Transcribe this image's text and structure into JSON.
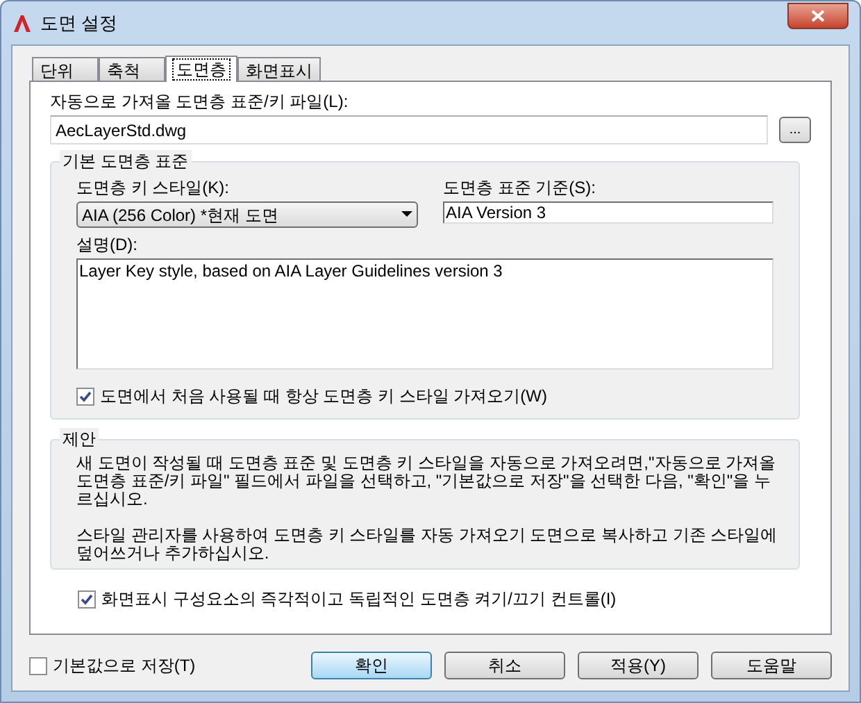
{
  "window": {
    "title": "도면 설정"
  },
  "tabs": [
    {
      "label": "단위",
      "selected": false
    },
    {
      "label": "축척",
      "selected": false
    },
    {
      "label": "도면층",
      "selected": true
    },
    {
      "label": "화면표시",
      "selected": false
    }
  ],
  "file": {
    "label": "자동으로 가져올 도면층 표준/키 파일(L):",
    "value": "AecLayerStd.dwg",
    "browse": "..."
  },
  "default_standard": {
    "title": "기본 도면층 표준",
    "key_style": {
      "label": "도면층 키 스타일(K):",
      "value": "AIA (256 Color) *현재 도면"
    },
    "standard": {
      "label": "도면층 표준 기준(S):",
      "value": "AIA Version 3"
    },
    "description": {
      "label": "설명(D):",
      "value": "Layer Key style, based on AIA Layer Guidelines version 3"
    },
    "always_import": {
      "label": "도면에서 처음 사용될 때 항상 도면층 키 스타일 가져오기(W)",
      "checked": true
    }
  },
  "suggestion": {
    "title": "제안",
    "paragraphs": [
      "새 도면이 작성될 때 도면층 표준 및 도면층 키 스타일을 자동으로 가져오려면,\"자동으로 가져올 도면층 표준/키 파일\" 필드에서 파일을 선택하고, \"기본값으로 저장\"을 선택한 다음, \"확인\"을 누르십시오.",
      "스타일 관리자를 사용하여 도면층 키 스타일를 자동 가져오기 도면으로 복사하고 기존 스타일에 덮어쓰거나 추가하십시오."
    ]
  },
  "display_control": {
    "label": "화면표시 구성요소의 즉각적이고 독립적인 도면층 켜기/끄기 컨트롤(I)",
    "checked": true
  },
  "save_default": {
    "label": "기본값으로 저장(T)",
    "checked": false
  },
  "buttons": [
    {
      "label": "확인",
      "default": true
    },
    {
      "label": "취소",
      "default": false
    },
    {
      "label": "적용(Y)",
      "default": false
    },
    {
      "label": "도움말",
      "default": false
    }
  ]
}
